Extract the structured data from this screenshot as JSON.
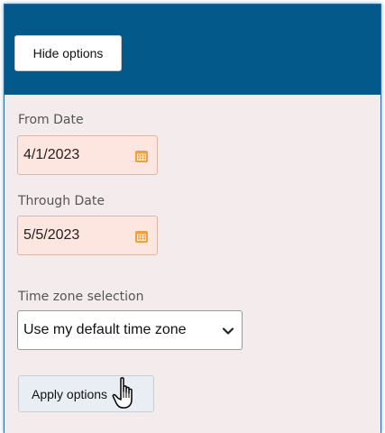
{
  "header": {
    "hide_options_label": "Hide options",
    "background_color": "#02598a"
  },
  "filters": {
    "from_date": {
      "label": "From Date",
      "value": "4/1/2023",
      "icon": "calendar-icon"
    },
    "through_date": {
      "label": "Through Date",
      "value": "5/5/2023",
      "icon": "calendar-icon"
    },
    "time_zone": {
      "label": "Time zone selection",
      "selected": "Use my default time zone",
      "icon": "chevron-down-icon"
    }
  },
  "actions": {
    "apply_options_label": "Apply options"
  },
  "cursor": {
    "icon": "hand-pointer-icon"
  },
  "colors": {
    "panel_background": "#f4ecec",
    "date_input_background": "#fce6df",
    "calendar_icon_color": "#f0a040"
  }
}
